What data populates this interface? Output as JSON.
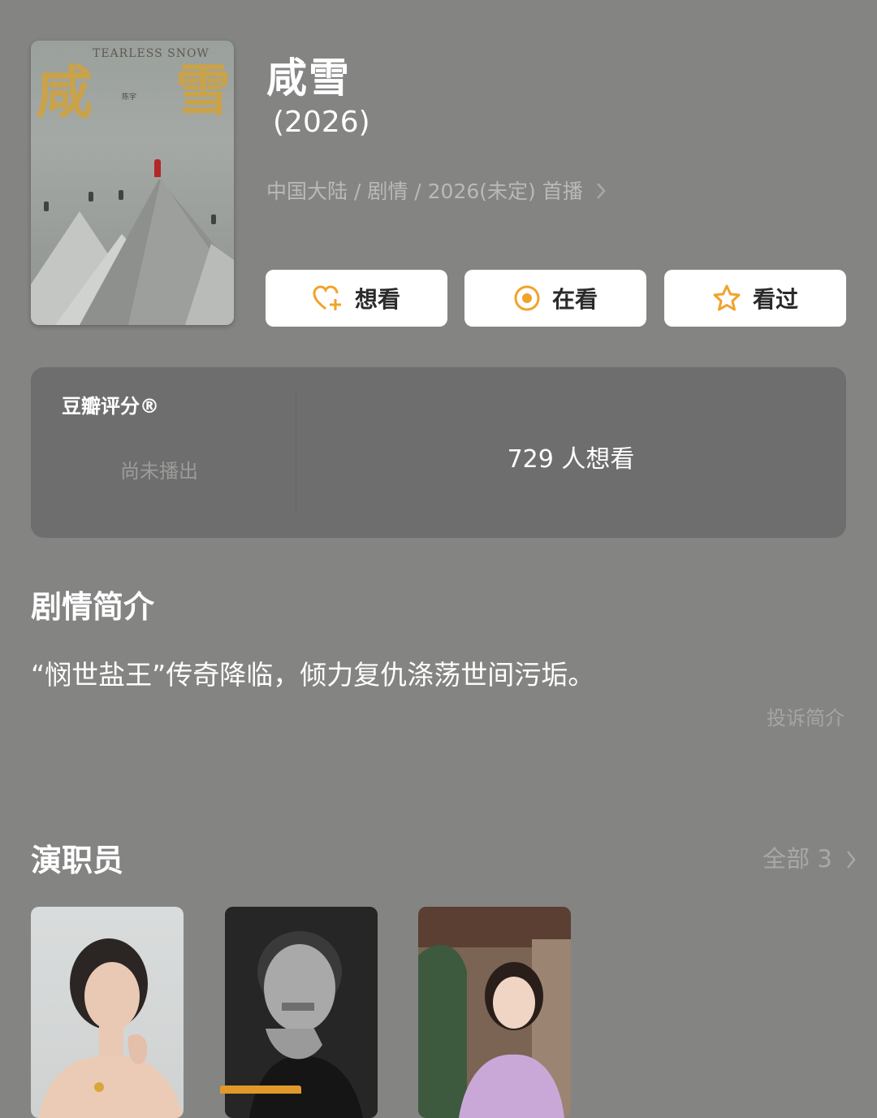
{
  "poster": {
    "title_chars": [
      "咸",
      "雪"
    ],
    "english_title": "TEARLESS SNOW",
    "director_text": "陈宇"
  },
  "header": {
    "title": "咸雪",
    "year": "(2026)",
    "meta": "中国大陆 / 剧情 / 2026(未定) 首播"
  },
  "actions": {
    "want_label": "想看",
    "watching_label": "在看",
    "watched_label": "看过"
  },
  "rating": {
    "label": "豆瓣评分®",
    "status": "尚未播出",
    "want_count_text": "729 人想看"
  },
  "summary": {
    "section_title": "剧情简介",
    "text": "“悯世盐王”传奇降临，倾力复仇涤荡世间污垢。",
    "report_label": "投诉简介"
  },
  "cast": {
    "section_title": "演职员",
    "all_label": "全部 3"
  },
  "colors": {
    "background": "#848583",
    "accent": "#e0992a",
    "card": "#6d6e6d"
  }
}
